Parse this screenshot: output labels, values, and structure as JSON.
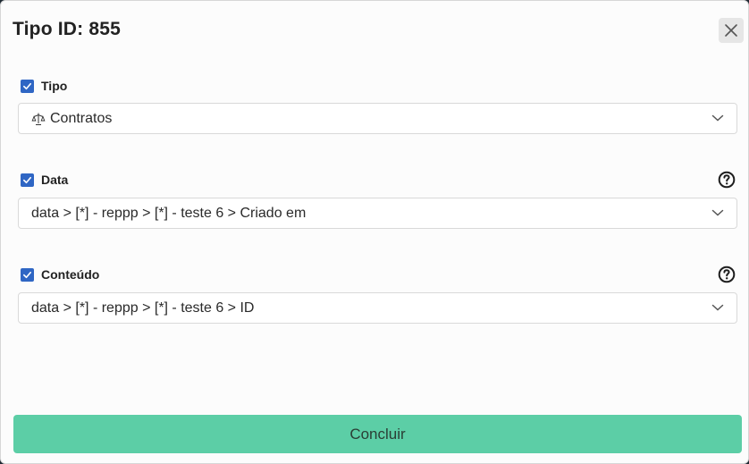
{
  "modal": {
    "title": "Tipo ID: 855"
  },
  "fields": [
    {
      "label": "Tipo",
      "checked": true,
      "value": "Contratos",
      "icon": "scale-icon",
      "has_help": false
    },
    {
      "label": "Data",
      "checked": true,
      "value": "data > [*] - reppp > [*] - teste 6 > Criado em",
      "has_help": true
    },
    {
      "label": "Conteúdo",
      "checked": true,
      "value": "data > [*] - reppp > [*] - teste 6 > ID",
      "has_help": true
    }
  ],
  "footer": {
    "submit_label": "Concluir"
  },
  "colors": {
    "checkbox": "#2f66c4",
    "submit_bg": "#5ccea6",
    "modal_bg": "#fcfcfc"
  }
}
